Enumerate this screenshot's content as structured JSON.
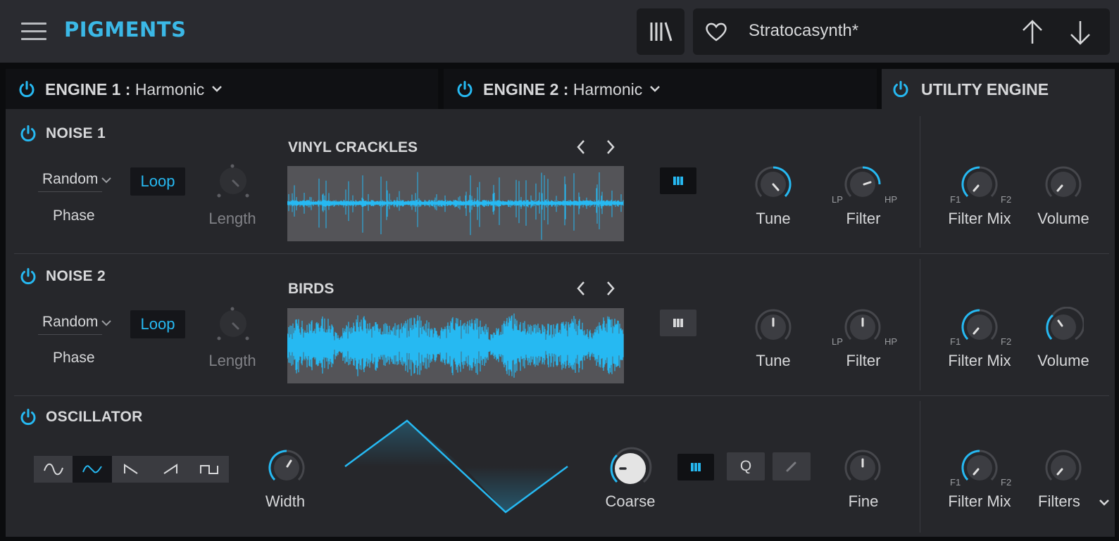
{
  "app": {
    "name": "PIGMENTS"
  },
  "header": {
    "preset_name": "Stratocasynth*"
  },
  "tabs": [
    {
      "prefix": "ENGINE 1 :",
      "type": "Harmonic"
    },
    {
      "prefix": "ENGINE 2 :",
      "type": "Harmonic"
    },
    {
      "label": "UTILITY ENGINE"
    }
  ],
  "noise1": {
    "title": "NOISE 1",
    "mode": "Random",
    "phase_label": "Phase",
    "loop_label": "Loop",
    "length_label": "Length",
    "sample": "VINYL CRACKLES",
    "keytrack_on": true,
    "tune_label": "Tune",
    "filter_label": "Filter",
    "lp": "LP",
    "hp": "HP",
    "filter_mix_label": "Filter Mix",
    "f1": "F1",
    "f2": "F2",
    "volume_label": "Volume"
  },
  "noise2": {
    "title": "NOISE 2",
    "mode": "Random",
    "phase_label": "Phase",
    "loop_label": "Loop",
    "length_label": "Length",
    "sample": "BIRDS",
    "keytrack_on": false,
    "tune_label": "Tune",
    "filter_label": "Filter",
    "lp": "LP",
    "hp": "HP",
    "filter_mix_label": "Filter Mix",
    "f1": "F1",
    "f2": "F2",
    "volume_label": "Volume"
  },
  "oscillator": {
    "title": "OSCILLATOR",
    "waveforms": [
      "sine",
      "triangle",
      "ramp-down",
      "saw",
      "square"
    ],
    "selected_waveform": "triangle",
    "width_label": "Width",
    "coarse_label": "Coarse",
    "q_label": "Q",
    "fine_label": "Fine",
    "filter_mix_label": "Filter Mix",
    "f1": "F1",
    "f2": "F2",
    "filters_label": "Filters"
  },
  "colors": {
    "accent": "#26b9f2",
    "panel": "#26272b",
    "topbar": "#2a2b30"
  }
}
